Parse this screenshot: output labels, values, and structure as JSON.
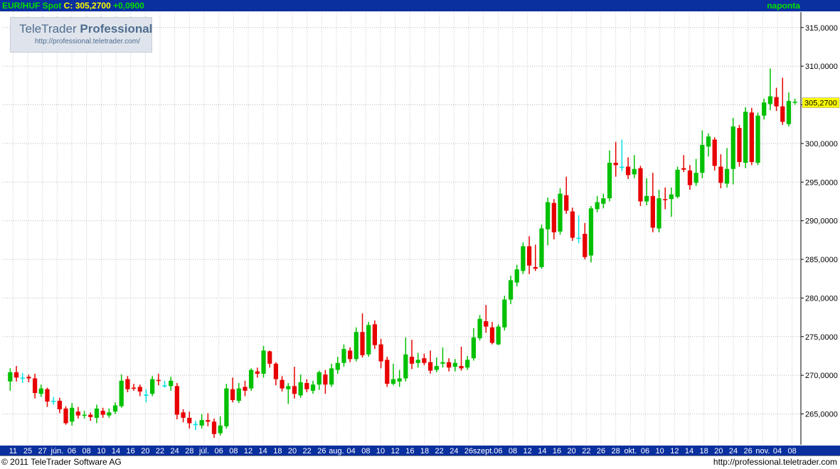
{
  "header": {
    "symbol": "EUR/HUF Spot",
    "close_label": "C:",
    "close_value": "305,2700",
    "change": "+0,0900",
    "period": "naponta"
  },
  "logo": {
    "brand_regular": "TeleTrader",
    "brand_bold": "Professional",
    "url": "http://professional.teletrader.com/"
  },
  "footer": {
    "copyright": "© 2011  TeleTrader Software AG",
    "url": "http://professional.teletrader.com"
  },
  "colors": {
    "up": "#00c000",
    "down": "#e80000",
    "neutral": "#00e0e0",
    "bar_bg": "#0a2f9e",
    "last_price_bg": "#ffff00"
  },
  "chart_data": {
    "type": "candlestick",
    "ylim": [
      261,
      317
    ],
    "y_ticks": [
      {
        "v": 315,
        "label": "315,0000"
      },
      {
        "v": 310,
        "label": "310,0000"
      },
      {
        "v": 305,
        "label": ""
      },
      {
        "v": 300,
        "label": "300,0000"
      },
      {
        "v": 295,
        "label": "295,0000"
      },
      {
        "v": 290,
        "label": "290,0000"
      },
      {
        "v": 285,
        "label": "285,0000"
      },
      {
        "v": 280,
        "label": "280,0000"
      },
      {
        "v": 275,
        "label": "275,0000"
      },
      {
        "v": 270,
        "label": "270,0000"
      },
      {
        "v": 265,
        "label": "265,0000"
      }
    ],
    "last_price": {
      "v": 305.27,
      "label": "305,2700"
    },
    "x_labels": [
      "11",
      "25",
      "27",
      "jún.",
      "06",
      "08",
      "10",
      "14",
      "16",
      "20",
      "22",
      "24",
      "28",
      "júl.",
      "06",
      "08",
      "12",
      "14",
      "18",
      "20",
      "22",
      "26",
      "aug.",
      "04",
      "08",
      "10",
      "12",
      "16",
      "18",
      "22",
      "24",
      "26",
      "szept.",
      "06",
      "08",
      "12",
      "14",
      "16",
      "20",
      "22",
      "26",
      "28",
      "okt.",
      "06",
      "10",
      "12",
      "14",
      "18",
      "20",
      "24",
      "26",
      "nov.",
      "04",
      "08"
    ],
    "candles": [
      [
        269.2,
        270.4,
        268.0,
        270.9
      ],
      [
        270.4,
        269.7,
        269.2,
        271.2
      ],
      [
        269.7,
        269.7,
        269.0,
        270.3
      ],
      [
        269.8,
        269.6,
        269.1,
        270.1
      ],
      [
        269.6,
        267.7,
        267.0,
        270.2
      ],
      [
        267.6,
        268.3,
        267.2,
        268.8
      ],
      [
        268.2,
        266.6,
        265.9,
        268.4
      ],
      [
        266.7,
        266.7,
        266.2,
        267.2
      ],
      [
        266.7,
        265.6,
        265.1,
        267.1
      ],
      [
        265.7,
        263.8,
        263.6,
        266.0
      ],
      [
        264.0,
        265.8,
        263.5,
        266.4
      ],
      [
        265.3,
        264.8,
        264.4,
        265.9
      ],
      [
        264.8,
        264.9,
        264.4,
        265.4
      ],
      [
        264.9,
        264.6,
        264.1,
        265.2
      ],
      [
        264.5,
        265.7,
        263.8,
        266.2
      ],
      [
        265.4,
        264.9,
        264.5,
        265.8
      ],
      [
        264.8,
        265.2,
        264.5,
        265.7
      ],
      [
        265.3,
        266.1,
        265.0,
        266.5
      ],
      [
        266.0,
        269.3,
        265.8,
        270.1
      ],
      [
        269.5,
        268.2,
        267.8,
        269.9
      ],
      [
        268.4,
        268.3,
        268.0,
        268.9
      ],
      [
        268.5,
        267.9,
        267.3,
        268.8
      ],
      [
        267.5,
        267.5,
        266.5,
        268.2
      ],
      [
        267.6,
        269.5,
        267.3,
        269.9
      ],
      [
        269.4,
        269.3,
        268.7,
        270.2
      ],
      [
        268.7,
        268.7,
        268.4,
        269.3
      ],
      [
        268.6,
        269.3,
        268.0,
        269.8
      ],
      [
        268.6,
        264.9,
        264.3,
        269.0
      ],
      [
        265.2,
        264.5,
        263.9,
        265.6
      ],
      [
        264.5,
        263.8,
        263.1,
        265.3
      ],
      [
        263.7,
        263.7,
        262.9,
        264.1
      ],
      [
        263.5,
        264.2,
        263.1,
        265.0
      ],
      [
        264.2,
        264.0,
        263.4,
        265.1
      ],
      [
        264.0,
        262.4,
        261.9,
        264.4
      ],
      [
        262.5,
        263.5,
        262.2,
        264.7
      ],
      [
        263.4,
        268.3,
        263.1,
        268.9
      ],
      [
        268.2,
        266.8,
        266.5,
        269.7
      ],
      [
        266.7,
        268.3,
        266.4,
        269.0
      ],
      [
        268.5,
        268.0,
        267.3,
        269.3
      ],
      [
        268.3,
        270.7,
        268.0,
        270.9
      ],
      [
        270.5,
        270.2,
        269.7,
        271.0
      ],
      [
        270.2,
        273.2,
        269.7,
        273.8
      ],
      [
        273.1,
        271.5,
        271.0,
        273.2
      ],
      [
        271.5,
        269.5,
        268.7,
        271.7
      ],
      [
        269.4,
        268.3,
        267.9,
        269.9
      ],
      [
        268.2,
        268.6,
        266.3,
        269.0
      ],
      [
        268.6,
        267.6,
        267.0,
        271.1
      ],
      [
        267.4,
        269.1,
        267.1,
        270.1
      ],
      [
        269.0,
        268.2,
        267.8,
        269.5
      ],
      [
        268.0,
        268.8,
        267.6,
        269.3
      ],
      [
        268.8,
        270.4,
        268.1,
        270.6
      ],
      [
        270.1,
        268.8,
        267.6,
        270.7
      ],
      [
        268.8,
        270.9,
        268.5,
        271.5
      ],
      [
        270.7,
        271.6,
        270.2,
        272.4
      ],
      [
        271.6,
        273.4,
        271.1,
        274.0
      ],
      [
        273.2,
        272.1,
        271.7,
        273.6
      ],
      [
        272.1,
        275.6,
        271.8,
        276.2
      ],
      [
        275.6,
        272.6,
        272.3,
        278.0
      ],
      [
        272.7,
        276.5,
        272.4,
        276.9
      ],
      [
        276.6,
        273.9,
        273.4,
        277.1
      ],
      [
        274.0,
        271.8,
        270.9,
        274.7
      ],
      [
        272.0,
        268.9,
        268.5,
        272.4
      ],
      [
        268.9,
        269.5,
        268.7,
        271.5
      ],
      [
        269.2,
        269.6,
        268.5,
        270.7
      ],
      [
        269.6,
        272.7,
        269.2,
        274.9
      ],
      [
        272.4,
        271.5,
        270.8,
        274.6
      ],
      [
        271.6,
        272.0,
        271.0,
        272.9
      ],
      [
        272.2,
        271.6,
        271.3,
        272.8
      ],
      [
        271.7,
        270.6,
        270.2,
        273.2
      ],
      [
        270.7,
        271.2,
        270.4,
        272.3
      ],
      [
        271.5,
        271.7,
        271.0,
        273.6
      ],
      [
        271.7,
        271.0,
        270.5,
        272.2
      ],
      [
        271.1,
        271.6,
        270.5,
        272.1
      ],
      [
        271.2,
        270.9,
        270.6,
        273.7
      ],
      [
        271.0,
        272.0,
        270.7,
        272.5
      ],
      [
        272.2,
        274.9,
        271.9,
        276.1
      ],
      [
        274.8,
        277.3,
        274.5,
        277.8
      ],
      [
        277.0,
        276.3,
        275.5,
        279.1
      ],
      [
        276.2,
        274.2,
        274.0,
        276.9
      ],
      [
        274.0,
        276.3,
        273.9,
        276.6
      ],
      [
        276.2,
        279.8,
        275.8,
        280.3
      ],
      [
        279.8,
        282.3,
        279.2,
        282.9
      ],
      [
        282.0,
        283.7,
        281.5,
        284.3
      ],
      [
        283.5,
        286.7,
        283.1,
        287.2
      ],
      [
        286.7,
        284.2,
        283.1,
        288.0
      ],
      [
        284.0,
        283.8,
        283.5,
        286.9
      ],
      [
        284.0,
        289.0,
        283.8,
        289.5
      ],
      [
        288.9,
        292.4,
        286.8,
        293.0
      ],
      [
        292.3,
        288.5,
        287.6,
        292.8
      ],
      [
        288.6,
        293.5,
        288.2,
        294.2
      ],
      [
        293.3,
        291.3,
        290.9,
        295.7
      ],
      [
        291.2,
        287.8,
        287.4,
        291.7
      ],
      [
        287.8,
        287.8,
        287.1,
        290.7
      ],
      [
        288.3,
        285.3,
        285.0,
        289.7
      ],
      [
        285.5,
        291.6,
        284.6,
        291.9
      ],
      [
        291.5,
        292.4,
        291.1,
        293.2
      ],
      [
        292.2,
        292.9,
        291.6,
        293.5
      ],
      [
        292.9,
        297.5,
        292.5,
        299.1
      ],
      [
        297.5,
        297.2,
        295.7,
        300.2
      ],
      [
        297.0,
        297.0,
        296.4,
        300.5
      ],
      [
        297.0,
        295.9,
        295.4,
        298.2
      ],
      [
        296.0,
        296.7,
        295.5,
        298.5
      ],
      [
        296.8,
        292.5,
        291.9,
        297.1
      ],
      [
        292.5,
        293.2,
        292.0,
        295.5
      ],
      [
        293.2,
        289.1,
        288.5,
        296.2
      ],
      [
        289.0,
        292.9,
        288.5,
        294.0
      ],
      [
        292.8,
        292.7,
        291.5,
        294.3
      ],
      [
        292.8,
        293.4,
        290.5,
        294.3
      ],
      [
        293.1,
        296.6,
        292.9,
        297.0
      ],
      [
        296.8,
        296.6,
        296.3,
        298.5
      ],
      [
        296.5,
        294.6,
        294.0,
        297.2
      ],
      [
        294.9,
        296.2,
        294.5,
        298.0
      ],
      [
        296.2,
        299.8,
        295.5,
        301.7
      ],
      [
        299.6,
        300.9,
        298.3,
        301.3
      ],
      [
        300.5,
        297.1,
        296.5,
        300.8
      ],
      [
        297.0,
        294.9,
        294.2,
        298.6
      ],
      [
        294.8,
        296.7,
        294.3,
        299.4
      ],
      [
        296.7,
        302.2,
        294.7,
        303.3
      ],
      [
        302.0,
        297.6,
        297.0,
        302.4
      ],
      [
        297.5,
        304.1,
        296.8,
        304.7
      ],
      [
        304.0,
        297.6,
        297.2,
        304.6
      ],
      [
        297.5,
        303.6,
        297.2,
        304.0
      ],
      [
        303.6,
        305.3,
        303.1,
        305.8
      ],
      [
        305.1,
        306.1,
        304.3,
        309.7
      ],
      [
        306.0,
        304.8,
        304.2,
        307.2
      ],
      [
        304.8,
        302.8,
        302.4,
        308.5
      ],
      [
        302.5,
        305.5,
        302.2,
        306.6
      ],
      [
        305.3,
        305.4,
        305.0,
        305.8
      ]
    ]
  }
}
